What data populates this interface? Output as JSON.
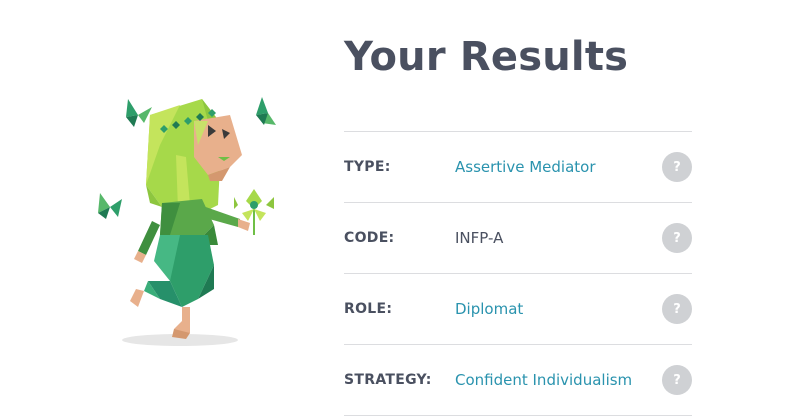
{
  "title": "Your Results",
  "rows": [
    {
      "label": "TYPE:",
      "value": "Assertive Mediator",
      "help": "?",
      "help_icon": "question-mark-icon"
    },
    {
      "label": "CODE:",
      "value": "INFP-A",
      "help": "?",
      "help_icon": "question-mark-icon"
    },
    {
      "label": "ROLE:",
      "value": "Diplomat",
      "help": "?",
      "help_icon": "question-mark-icon"
    },
    {
      "label": "STRATEGY:",
      "value": "Confident Individualism",
      "help": "?",
      "help_icon": "question-mark-icon"
    }
  ],
  "illustration": {
    "name": "mediator-character-illustration",
    "colors": {
      "leaf_green": "#8dc63f",
      "dark_green": "#2e9e6a",
      "skin": "#e8b08c",
      "shadow": "#e5e5e5"
    }
  },
  "colors": {
    "title": "#4a5060",
    "link": "#2a93ae",
    "divider": "#dcdde0",
    "help_bg": "#cfd1d4"
  }
}
